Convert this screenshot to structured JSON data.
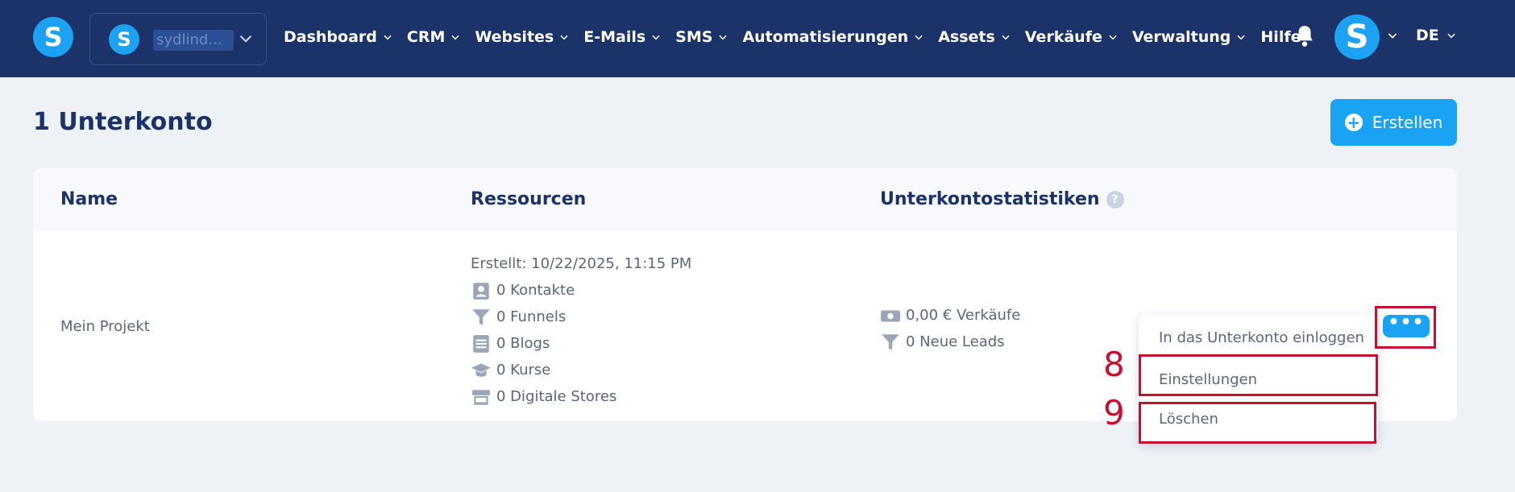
{
  "nav": {
    "logo_letter": "S",
    "account": {
      "avatar_letter": "S",
      "name": "sydlind..."
    },
    "menu": [
      {
        "label": "Dashboard",
        "has_dropdown": true
      },
      {
        "label": "CRM",
        "has_dropdown": true
      },
      {
        "label": "Websites",
        "has_dropdown": true
      },
      {
        "label": "E-Mails",
        "has_dropdown": true
      },
      {
        "label": "SMS",
        "has_dropdown": true
      },
      {
        "label": "Automatisierungen",
        "has_dropdown": true
      },
      {
        "label": "Assets",
        "has_dropdown": true
      },
      {
        "label": "Verkäufe",
        "has_dropdown": true
      },
      {
        "label": "Verwaltung",
        "has_dropdown": true
      },
      {
        "label": "Hilfe",
        "has_dropdown": false
      }
    ],
    "user_avatar_letter": "S",
    "language": "DE"
  },
  "page": {
    "title": "1 Unterkonto",
    "create_label": "Erstellen"
  },
  "table": {
    "headers": {
      "name": "Name",
      "resources": "Ressourcen",
      "stats": "Unterkontostatistiken",
      "stats_help": "?"
    },
    "row": {
      "name": "Mein Projekt",
      "created": "Erstellt: 10/22/2025, 11:15 PM",
      "resources": [
        {
          "icon": "contacts-icon",
          "label": "0 Kontakte"
        },
        {
          "icon": "funnel-icon",
          "label": "0 Funnels"
        },
        {
          "icon": "blog-icon",
          "label": "0 Blogs"
        },
        {
          "icon": "graduation-cap-icon",
          "label": "0 Kurse"
        },
        {
          "icon": "store-icon",
          "label": "0 Digitale Stores"
        }
      ],
      "stats": [
        {
          "icon": "money-icon",
          "label": "0,00 € Verkäufe"
        },
        {
          "icon": "funnel-icon",
          "label": "0 Neue Leads"
        }
      ]
    }
  },
  "dropdown": {
    "trigger": "•••",
    "items": [
      "In das Unterkonto einloggen",
      "Einstellungen",
      "Löschen"
    ]
  },
  "annotations": {
    "settings_marker": "8",
    "delete_marker": "9"
  },
  "colors": {
    "nav_bg": "#1b3368",
    "accent": "#1aa3f5",
    "highlight": "#c8102e"
  }
}
